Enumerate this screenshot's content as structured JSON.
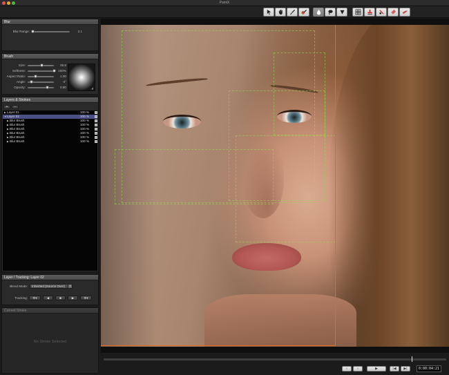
{
  "app": {
    "title": "PaintX"
  },
  "toolbar": {
    "tools": [
      {
        "icon": "pointer-icon"
      },
      {
        "icon": "hand-icon"
      },
      {
        "icon": "brush-icon"
      },
      {
        "icon": "clone-brush-icon"
      },
      {
        "icon": "blur-drop-icon",
        "active": true
      },
      {
        "icon": "lasso-icon"
      },
      {
        "icon": "triangle-down-icon"
      },
      {
        "icon": "grid-icon"
      },
      {
        "icon": "stamp-icon"
      },
      {
        "icon": "multi-brush-icon"
      },
      {
        "icon": "eraser-icon"
      },
      {
        "icon": "smudge-icon"
      }
    ]
  },
  "blur_panel": {
    "title": "Blur",
    "range_label": "Blur Range:",
    "range_value": "2.1",
    "range_fraction": 0.03
  },
  "brush_panel": {
    "title": "Brush",
    "params": [
      {
        "label": "Size:",
        "value": "35.8",
        "fraction": 0.55
      },
      {
        "label": "Softness:",
        "value": "100%",
        "fraction": 1.0
      },
      {
        "label": "Aspect Ratio:",
        "value": "1.00",
        "fraction": 0.3
      },
      {
        "label": "Angle:",
        "value": "0°",
        "fraction": 0.15
      },
      {
        "label": "Opacity:",
        "value": "0.80",
        "fraction": 0.75
      }
    ]
  },
  "layers_panel": {
    "title": "Layers & Strokes",
    "add_label": "+",
    "remove_label": "−",
    "rows": [
      {
        "name": "Layer 01",
        "opacity": "100 %",
        "level": 0,
        "expanded": false,
        "selected": false
      },
      {
        "name": "Layer 02",
        "opacity": "100 %",
        "level": 0,
        "expanded": true,
        "selected": true
      },
      {
        "name": "Blur Brush",
        "opacity": "100 %",
        "level": 1,
        "expanded": false,
        "selected": false
      },
      {
        "name": "Blur Brush",
        "opacity": "100 %",
        "level": 1,
        "expanded": false,
        "selected": false
      },
      {
        "name": "Blur Brush",
        "opacity": "100 %",
        "level": 1,
        "expanded": false,
        "selected": false
      },
      {
        "name": "Blur Brush",
        "opacity": "100 %",
        "level": 1,
        "expanded": false,
        "selected": false
      },
      {
        "name": "Blur Brush",
        "opacity": "100 %",
        "level": 1,
        "expanded": false,
        "selected": false
      },
      {
        "name": "Blur Brush",
        "opacity": "100 %",
        "level": 1,
        "expanded": false,
        "selected": false
      }
    ]
  },
  "tracking_panel": {
    "title": "Layer / Tracking: Layer 02",
    "blend_label": "Blend Mode:",
    "blend_value": "Inherited (Source Over)",
    "tracking_label": "Tracking:",
    "tracking_buttons": [
      "◀",
      "■",
      "▶"
    ]
  },
  "stroke_panel": {
    "title": "Current Stroke",
    "empty_message": "No Stroke Selected"
  },
  "transport": {
    "buttons": [
      "‹",
      "›",
      "▶",
      "|◀",
      "▶|",
      "▶▶"
    ],
    "timecode": "0:00:04:21",
    "playhead_fraction": 0.9
  }
}
